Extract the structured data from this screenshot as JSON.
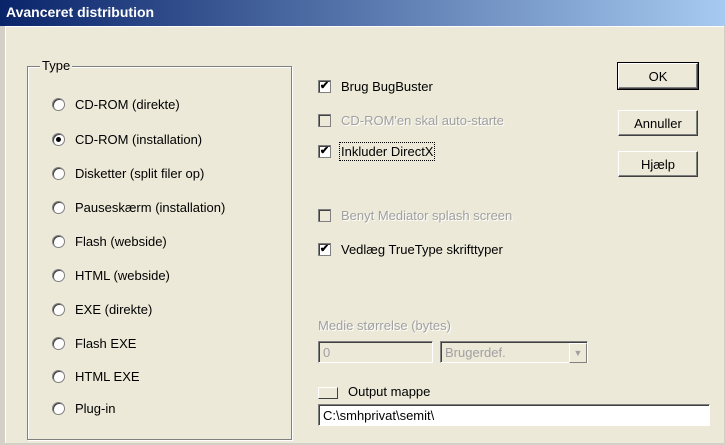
{
  "window": {
    "title": "Avanceret distribution"
  },
  "type_group": {
    "label": "Type",
    "options": [
      {
        "label": "CD-ROM (direkte)",
        "checked": false
      },
      {
        "label": "CD-ROM (installation)",
        "checked": true
      },
      {
        "label": "Disketter (split filer op)",
        "checked": false
      },
      {
        "label": "Pauseskærm (installation)",
        "checked": false
      },
      {
        "label": "Flash (webside)",
        "checked": false
      },
      {
        "label": "HTML (webside)",
        "checked": false
      },
      {
        "label": "EXE (direkte)",
        "checked": false
      },
      {
        "label": "Flash EXE",
        "checked": false
      },
      {
        "label": "HTML EXE",
        "checked": false
      },
      {
        "label": "Plug-in",
        "checked": false
      }
    ]
  },
  "options": {
    "bugbuster": {
      "label": "Brug BugBuster",
      "checked": true,
      "enabled": true
    },
    "autostart": {
      "label": "CD-ROM'en skal auto-starte",
      "checked": false,
      "enabled": false
    },
    "directx": {
      "label": "Inkluder DirectX",
      "checked": true,
      "enabled": true
    },
    "mediator_splash": {
      "label": "Benyt Mediator splash screen",
      "checked": false,
      "enabled": false
    },
    "truetype": {
      "label": "Vedlæg TrueType skrifttyper",
      "checked": true,
      "enabled": true
    }
  },
  "media": {
    "label": "Medie størrelse (bytes)",
    "size_value": "0",
    "combo_value": "Brugerdef."
  },
  "output": {
    "label": "Output mappe",
    "path": "C:\\smhprivat\\semit\\"
  },
  "buttons": {
    "ok": "OK",
    "cancel": "Annuller",
    "help": "Hjælp"
  },
  "glyphs": {
    "check": "✔",
    "combo_arrow": "▼"
  }
}
